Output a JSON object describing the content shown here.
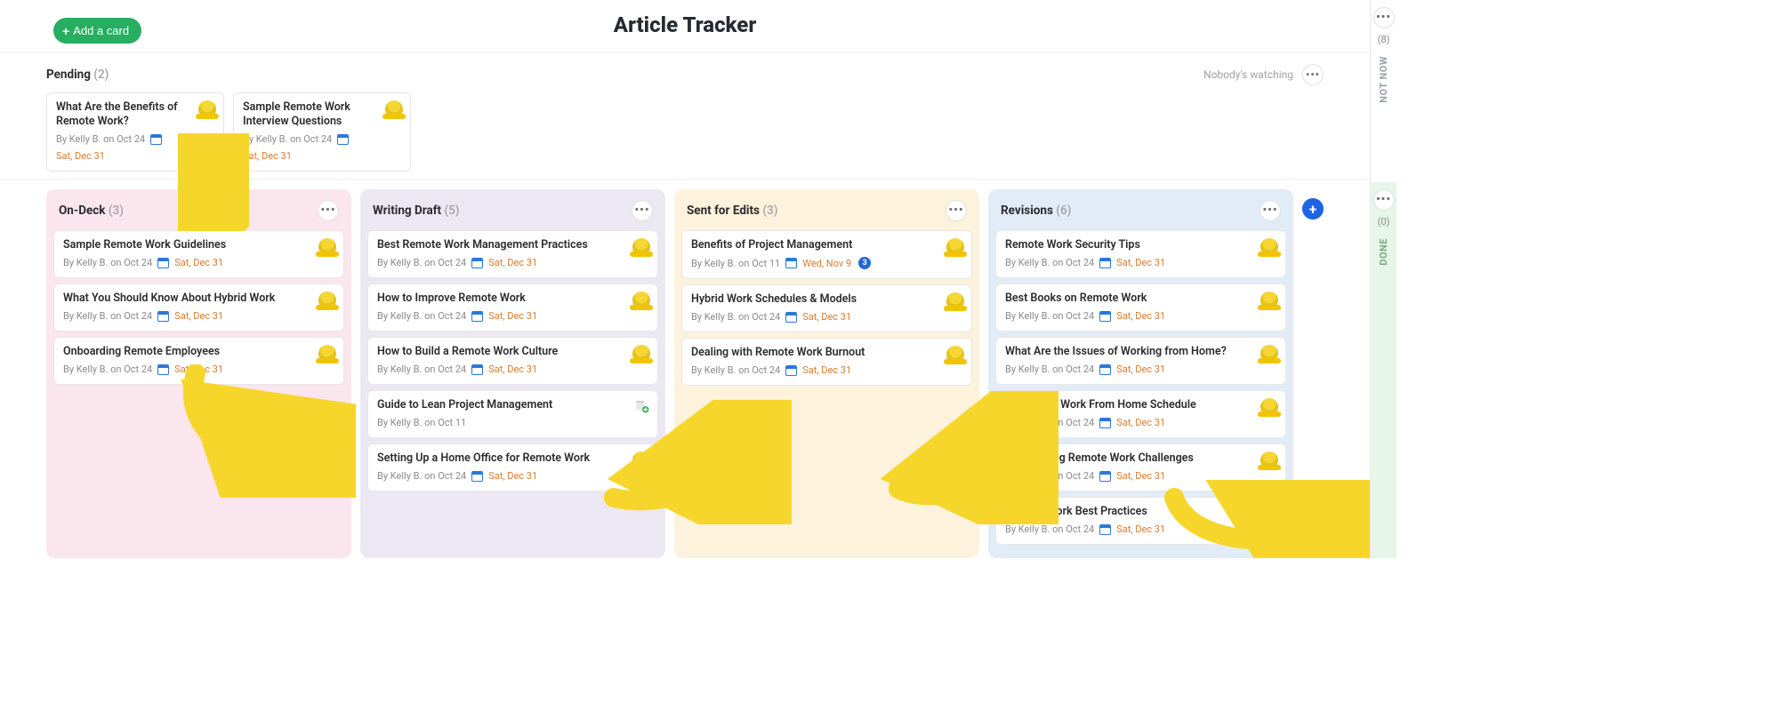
{
  "header": {
    "add_card_label": "Add a card",
    "board_title": "Article Tracker"
  },
  "pending_strip": {
    "title": "Pending",
    "count": "(2)",
    "watchers_text": "Nobody's watching",
    "cards": [
      {
        "title": "What Are the Benefits of Remote Work?",
        "byline": "By Kelly B. on Oct 24",
        "due": "Sat, Dec 31"
      },
      {
        "title": "Sample Remote Work Interview Questions",
        "byline": "By Kelly B. on Oct 24",
        "due": "Sat, Dec 31"
      }
    ]
  },
  "rail": {
    "notnow": {
      "count": "(8)",
      "label": "NOT NOW"
    },
    "done": {
      "count": "(0)",
      "label": "DONE"
    }
  },
  "columns": [
    {
      "id": "ondeck",
      "title": "On-Deck",
      "count": "(3)",
      "color": "pink",
      "cards": [
        {
          "title": "Sample Remote Work Guidelines",
          "byline": "By Kelly B. on Oct 24",
          "due": "Sat, Dec 31"
        },
        {
          "title": "What You Should Know About Hybrid Work",
          "byline": "By Kelly B. on Oct 24",
          "due": "Sat, Dec 31"
        },
        {
          "title": "Onboarding Remote Employees",
          "byline": "By Kelly B. on Oct 24",
          "due": "Sat, Dec 31"
        }
      ]
    },
    {
      "id": "writing",
      "title": "Writing Draft",
      "count": "(5)",
      "color": "purple",
      "cards": [
        {
          "title": "Best Remote Work Management Practices",
          "byline": "By Kelly B. on Oct 24",
          "due": "Sat, Dec 31"
        },
        {
          "title": "How to Improve Remote Work",
          "byline": "By Kelly B. on Oct 24",
          "due": "Sat, Dec 31"
        },
        {
          "title": "How to Build a Remote Work Culture",
          "byline": "By Kelly B. on Oct 24",
          "due": "Sat, Dec 31"
        },
        {
          "title": "Guide to Lean Project Management",
          "byline": "By Kelly B. on Oct 11",
          "due": "",
          "assign": true
        },
        {
          "title": "Setting Up a Home Office for Remote Work",
          "byline": "By Kelly B. on Oct 24",
          "due": "Sat, Dec 31"
        }
      ]
    },
    {
      "id": "sent",
      "title": "Sent for Edits",
      "count": "(3)",
      "color": "cream",
      "cards": [
        {
          "title": "Benefits of Project Management",
          "byline": "By Kelly B. on Oct 11",
          "due": "Wed, Nov 9",
          "badge": "3"
        },
        {
          "title": "Hybrid Work Schedules & Models",
          "byline": "By Kelly B. on Oct 24",
          "due": "Sat, Dec 31"
        },
        {
          "title": "Dealing with Remote Work Burnout",
          "byline": "By Kelly B. on Oct 24",
          "due": "Sat, Dec 31"
        }
      ]
    },
    {
      "id": "revisions",
      "title": "Revisions",
      "count": "(6)",
      "color": "blue",
      "cards": [
        {
          "title": "Remote Work Security Tips",
          "byline": "By Kelly B. on Oct 24",
          "due": "Sat, Dec 31"
        },
        {
          "title": "Best Books on Remote Work",
          "byline": "By Kelly B. on Oct 24",
          "due": "Sat, Dec 31"
        },
        {
          "title": "What Are the Issues of Working from Home?",
          "byline": "By Kelly B. on Oct 24",
          "due": "Sat, Dec 31"
        },
        {
          "title": "Creating A Work From Home Schedule",
          "byline": "By Kelly B. on Oct 24",
          "due": "Sat, Dec 31"
        },
        {
          "title": "Overcoming Remote Work Challenges",
          "byline": "By Kelly B. on Oct 24",
          "due": "Sat, Dec 31"
        },
        {
          "title": "Remote Work Best Practices",
          "byline": "By Kelly B. on Oct 24",
          "due": "Sat, Dec 31"
        }
      ]
    }
  ]
}
